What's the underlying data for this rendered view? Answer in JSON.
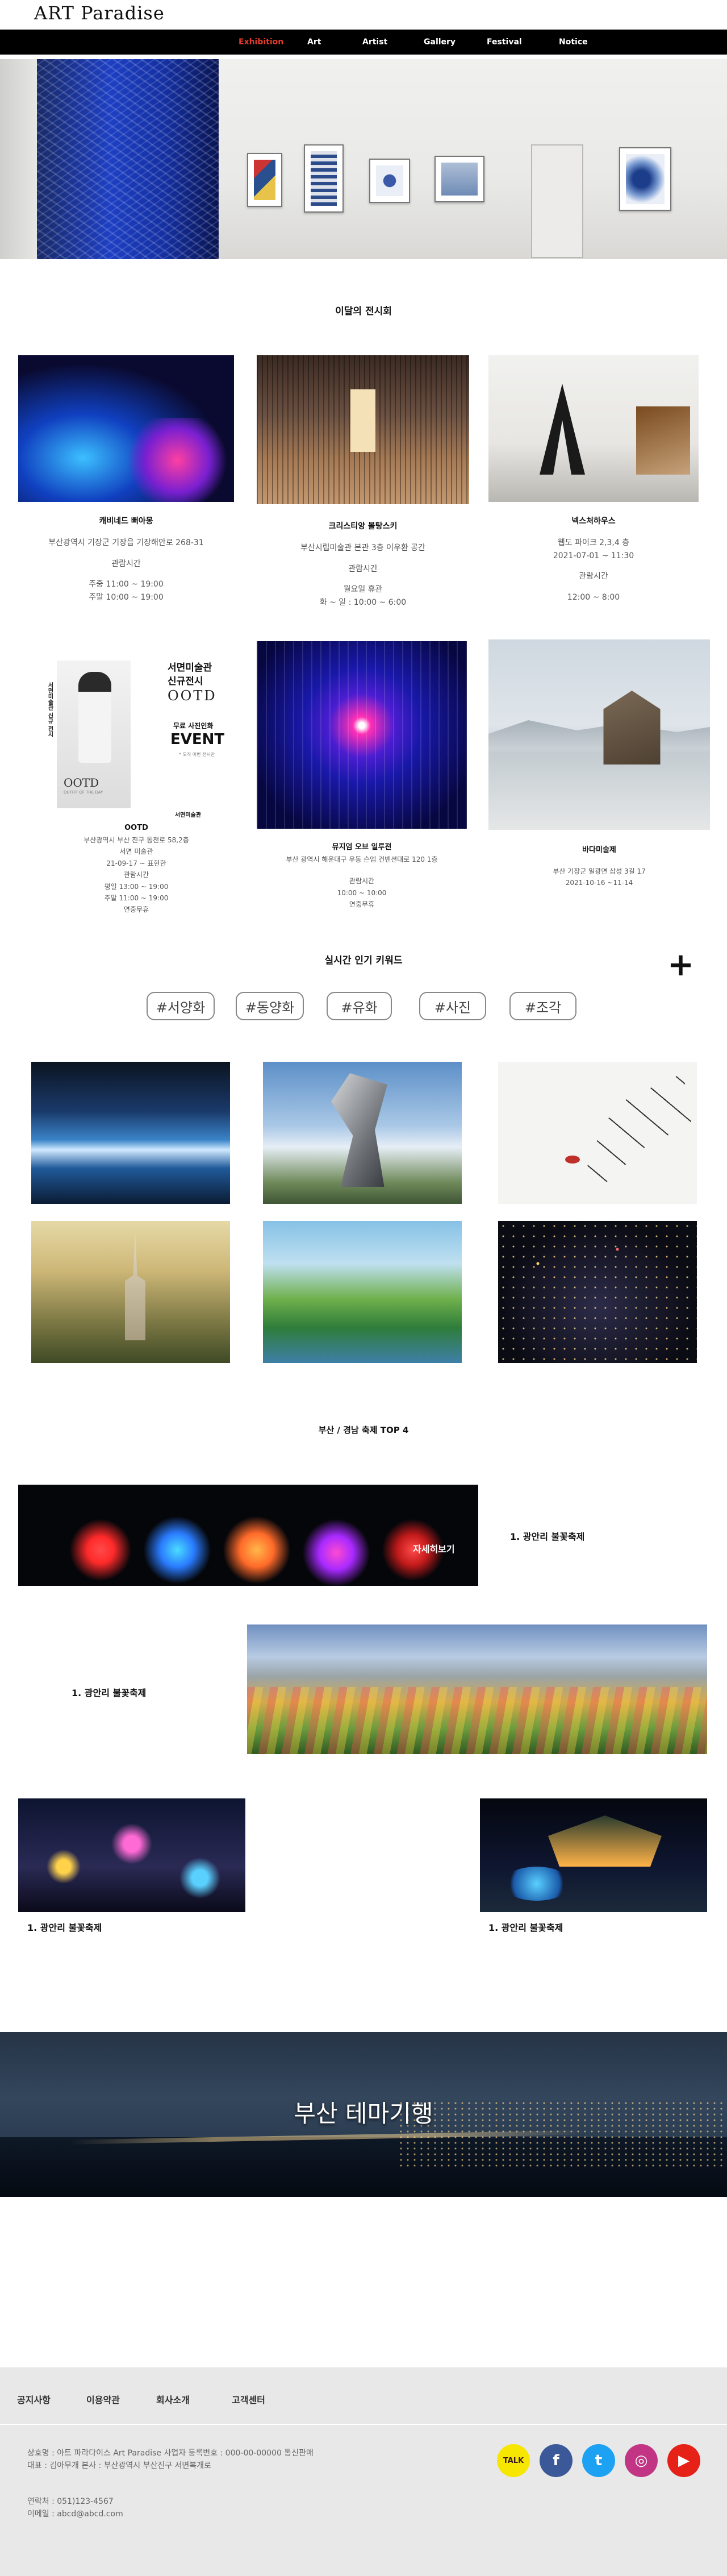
{
  "header": {
    "logo": "ART Paradise",
    "nav": [
      "Exhibition",
      "Art",
      "Artist",
      "Gallery",
      "Festival",
      "Notice"
    ],
    "active_color": "#e03b2b"
  },
  "exhibitions": {
    "title": "이달의 전시회",
    "cards": [
      {
        "name": "캐비네드 뻐아몽",
        "lines": [
          "부산광역시 기장군 기장읍 기장해안로 268-31",
          "",
          "관람시간",
          "",
          "주중 11:00 ~ 19:00",
          "주말 10:00 ~ 19:00"
        ]
      },
      {
        "name": "크리스티앙 볼탕스키",
        "lines": [
          "부산시립미술관 본관 3층 이우환 공간",
          "",
          "관람시간",
          "",
          "월요일 휴관",
          "화 ~ 일 : 10:00 ~ 6:00"
        ]
      },
      {
        "name": "넥스처하우스",
        "lines": [
          "웹도 파이크 2,3,4 층",
          "2021-07-01 ~ 11:30",
          "",
          "관람시간",
          "",
          "12:00 ~ 8:00"
        ]
      },
      {
        "name": "OOTD",
        "lines": [
          "부산광역시 부산 진구 동천로 58,2층",
          "서면 미술관",
          "21-09-17 ~ 표현한",
          "관람시간",
          "평일 13:00 ~ 19:00",
          "주말 11:00 ~ 19:00",
          "연중무휴"
        ]
      },
      {
        "name": "뮤지엄 오브 일루젼",
        "lines": [
          "부산 광역시 해운대구 우동 슨엠 컨벤션대로 120 1층",
          "",
          "관람시간",
          "10:00 ~ 10:00",
          "연중무휴"
        ]
      },
      {
        "name": "바다미술제",
        "lines": [
          "부산 기장군 일광면 삼성 3길 17",
          "2021-10-16 ~11-14"
        ]
      }
    ],
    "poster": {
      "title1": "서면미술관",
      "title2": "신규전시",
      "title3": "OOTD",
      "event1": "무료 사진인화",
      "event2": "EVENT",
      "small": "* 오직 이번 전시만",
      "side": "서면미술관 신규 전시",
      "caption": "OOTD",
      "sub": "OUTFIT OF THE DAY",
      "brand": "서면미술관"
    }
  },
  "keywords": {
    "title": "실시간 인기 키워드",
    "plus": "+",
    "items": [
      "#서양화",
      "#동양화",
      "#유화",
      "#사진",
      "#조각"
    ]
  },
  "festival": {
    "title": "부산  / 경남 축제 TOP 4",
    "detail": "자세히보기",
    "labels": [
      "1. 광안리 불꽃축제",
      "1. 광안리 불꽃축제",
      "1. 광안리 불꽃축제",
      "1. 광안리 불꽃축제"
    ]
  },
  "banner": {
    "text": "부산 테마기행"
  },
  "footer": {
    "links": [
      "공지사항",
      "이용약관",
      "회사소개",
      "고객센터"
    ],
    "info": [
      "상호명 : 아트 파라다이스 Art Paradise   사업자 등록번호 : 000-00-00000 통신판매",
      "대표 : 김아무개  본사 : 부산광역시 부산진구 서면복개로",
      "",
      "연락처 : 051)123-4567",
      "이메일 : abcd@abcd.com"
    ],
    "social": [
      {
        "name": "kakao-icon",
        "label": "TALK",
        "color": "#f7e600"
      },
      {
        "name": "facebook-icon",
        "label": "f",
        "color": "#3b5998"
      },
      {
        "name": "twitter-icon",
        "label": "t",
        "color": "#1da1f2"
      },
      {
        "name": "instagram-icon",
        "label": "◎",
        "color": "#c13584"
      },
      {
        "name": "youtube-icon",
        "label": "▶",
        "color": "#e62117"
      }
    ]
  }
}
